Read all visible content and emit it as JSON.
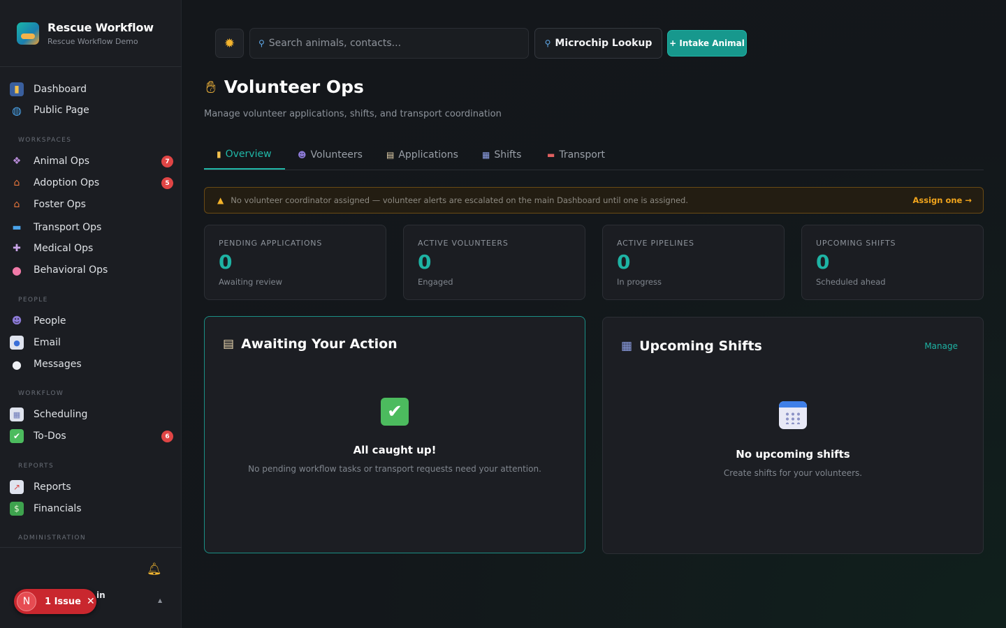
{
  "brand": {
    "title": "Rescue Workflow",
    "subtitle": "Rescue Workflow Demo"
  },
  "sidebar": {
    "top_items": [
      {
        "label": "Dashboard",
        "icon": "bar-chart-icon"
      },
      {
        "label": "Public Page",
        "icon": "globe-icon"
      }
    ],
    "sections": [
      {
        "title": "WORKSPACES",
        "items": [
          {
            "label": "Animal Ops",
            "icon": "paw-icon",
            "badge": "7"
          },
          {
            "label": "Adoption Ops",
            "icon": "house-icon",
            "badge": "5"
          },
          {
            "label": "Foster Ops",
            "icon": "house-icon",
            "badge": ""
          },
          {
            "label": "Transport Ops",
            "icon": "van-icon",
            "badge": ""
          },
          {
            "label": "Medical Ops",
            "icon": "medical-icon",
            "badge": ""
          },
          {
            "label": "Behavioral Ops",
            "icon": "brain-icon",
            "badge": ""
          }
        ]
      },
      {
        "title": "PEOPLE",
        "items": [
          {
            "label": "People",
            "icon": "people-icon",
            "badge": ""
          },
          {
            "label": "Email",
            "icon": "email-icon",
            "badge": ""
          },
          {
            "label": "Messages",
            "icon": "speech-bubble-icon",
            "badge": ""
          }
        ]
      },
      {
        "title": "WORKFLOW",
        "items": [
          {
            "label": "Scheduling",
            "icon": "calendar-icon",
            "badge": ""
          },
          {
            "label": "To-Dos",
            "icon": "checkbox-icon",
            "badge": "6"
          }
        ]
      },
      {
        "title": "REPORTS",
        "items": [
          {
            "label": "Reports",
            "icon": "line-chart-icon",
            "badge": ""
          },
          {
            "label": "Financials",
            "icon": "money-icon",
            "badge": ""
          }
        ]
      },
      {
        "title": "ADMINISTRATION",
        "items": []
      }
    ],
    "issue_pill": {
      "avatar": "N",
      "label": "1 Issue"
    },
    "user_peek": "in"
  },
  "topbar": {
    "search_placeholder": "Search animals, contacts...",
    "microchip_label": "Microchip Lookup",
    "intake_label": "+ Intake Animal"
  },
  "page": {
    "title": "Volunteer Ops",
    "subtitle": "Manage volunteer applications, shifts, and transport coordination"
  },
  "tabs": [
    {
      "label": "Overview",
      "active": true
    },
    {
      "label": "Volunteers",
      "active": false
    },
    {
      "label": "Applications",
      "active": false
    },
    {
      "label": "Shifts",
      "active": false
    },
    {
      "label": "Transport",
      "active": false
    }
  ],
  "alert": {
    "text": "No volunteer coordinator assigned — volunteer alerts are escalated on the main Dashboard until one is assigned.",
    "link": "Assign one →"
  },
  "stats": [
    {
      "label": "PENDING APPLICATIONS",
      "value": "0",
      "sub": "Awaiting review"
    },
    {
      "label": "ACTIVE VOLUNTEERS",
      "value": "0",
      "sub": "Engaged"
    },
    {
      "label": "ACTIVE PIPELINES",
      "value": "0",
      "sub": "In progress"
    },
    {
      "label": "UPCOMING SHIFTS",
      "value": "0",
      "sub": "Scheduled ahead"
    }
  ],
  "panels": {
    "awaiting": {
      "title": "Awaiting Your Action",
      "empty_title": "All caught up!",
      "empty_sub": "No pending workflow tasks or transport requests need your attention."
    },
    "shifts": {
      "title": "Upcoming Shifts",
      "link": "Manage",
      "empty_title": "No upcoming shifts",
      "empty_sub": "Create shifts for your volunteers."
    }
  },
  "colors": {
    "accent": "#1eb3a4",
    "badge": "#e04545",
    "warning": "#f2a51c"
  }
}
